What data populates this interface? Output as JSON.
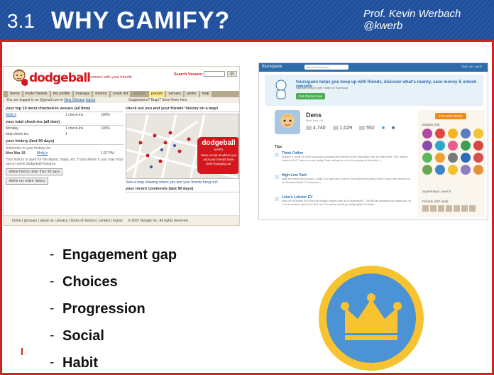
{
  "header": {
    "number": "3.1",
    "title": "WHY GAMIFY?",
    "author": "Prof. Kevin Werbach",
    "handle": "@kwerb"
  },
  "dodgeball": {
    "logo": "dodgeball",
    "tagline": "connect with your friends",
    "search_label": "Search Venues:",
    "search_button": "go",
    "tabs": [
      "home",
      "invite friends",
      "my profile",
      "manage",
      "history",
      "crush list",
      "search",
      "people",
      "venues",
      "perks",
      "help"
    ],
    "selected_tab": "people",
    "logged_in_prefix": "You are logged in as",
    "email": "@gmail.com",
    "location_prefix": "in",
    "location": "New Orleans",
    "logout": "logout",
    "suggestions": "Suggestions? Bugs? Send them here",
    "top10_header": "your top 10 most checked-in venues (all time)",
    "top10_rows": [
      {
        "venue": "Molly's",
        "checkins": "1 check-ins",
        "pct": "100%"
      }
    ],
    "total_header": "your total check-ins (all time)",
    "total_rows": [
      {
        "label": "Monday",
        "checkins": "1 check-ins",
        "pct": "100%"
      },
      {
        "label": "total check-ins",
        "checkins": "1",
        "pct": ""
      }
    ],
    "history_header": "your history (last 90 days)",
    "subscribe_text": "Subscribe to your history via:",
    "history_rows": [
      {
        "date": "Mon Mar 19",
        "venue": "Molly's",
        "time": "1:37 PM"
      }
    ],
    "history_note": "Your history is used for the digest, maps, etc. If you delete it, you may miss out on some dodgeball features.",
    "delete_old_button": "delete history older than 90 days",
    "delete_all_button": "delete my entire history",
    "map_header": "check out you and your friends' history on a map!",
    "map_bubble_title": "dodgeball",
    "map_bubble_sub": "MAPS",
    "map_bubble_text": "Have a look at where you and your friends have been hanging out",
    "map_caption": "View a map showing where you and your friends hang out!",
    "comments_header": "your recent comments (last 90 days)",
    "footer_links": [
      "home",
      "glossary",
      "about us",
      "privacy",
      "terms of service",
      "contact",
      "logout"
    ],
    "copyright": "© 2007 Google Inc. All rights reserved."
  },
  "foursquare": {
    "logo": "foursquare",
    "search_placeholder": "search foursquare",
    "top_links": "Sign up   Log in",
    "banner_heading": "foursquare helps you keep up with friends, discover what's nearby, save money & unlock rewards",
    "banner_sub": "Sign up or log in with Twitter or Facebook",
    "banner_button": "Get Started Now",
    "profile_name": "Dens",
    "profile_location": "New York, NY",
    "stats": [
      "4,740",
      "1,029",
      "552"
    ],
    "tips_header": "Tips",
    "tips": [
      {
        "title": "Think Coffee",
        "text": "Number 4 / such 15 of the foursquare probably best brewery at the back table near the bathrooms. This 'sleeper' feature in NYC came from our buddy Chad making fun of us for camping all that table. :)"
      },
      {
        "title": "High Line Park",
        "text": "Walk the whole thing (bonus = walk). It is night time, look for the architecture (being Chan Thing or the windows of the Standard Hotel. 2x if summer.)"
      },
      {
        "title": "Luke's Lobster EV",
        "text": "Best roll for lobster on in the East Village (maybe even all of Manhattan?). The $8 half sandwich roll makes you cry if it's as small as spit for the $14 one. For serious points go splitty-splitty w/ lobster."
      }
    ],
    "follow_button": "FOLLOW DENS",
    "badges_header": "Badges (53)",
    "badge_colors": [
      "#b04a9c",
      "#e0473e",
      "#f2b623",
      "#5c7cc4",
      "#f7c334",
      "#8a4bab",
      "#2aa9c9",
      "#e85e8a",
      "#3e9e52",
      "#d9463d",
      "#5cb85c",
      "#f0a030",
      "#7a7a7a",
      "#2c6ebd",
      "#d94f4f",
      "#6aa84f",
      "#3d85c6",
      "#f1c232",
      "#8e7cc3",
      "#e69138"
    ],
    "mayor_text": "Supermayor Level II",
    "friends_header": "Friends (287 total)"
  },
  "bullets": [
    "Engagement gap",
    "Choices",
    "Progression",
    "Social",
    "Habit"
  ],
  "colors": {
    "header_bg": "#1f4f9c",
    "frame_red": "#d32222",
    "badge_ring": "#f7c331",
    "badge_inner": "#4b93d4",
    "crown": "#f7c331"
  }
}
